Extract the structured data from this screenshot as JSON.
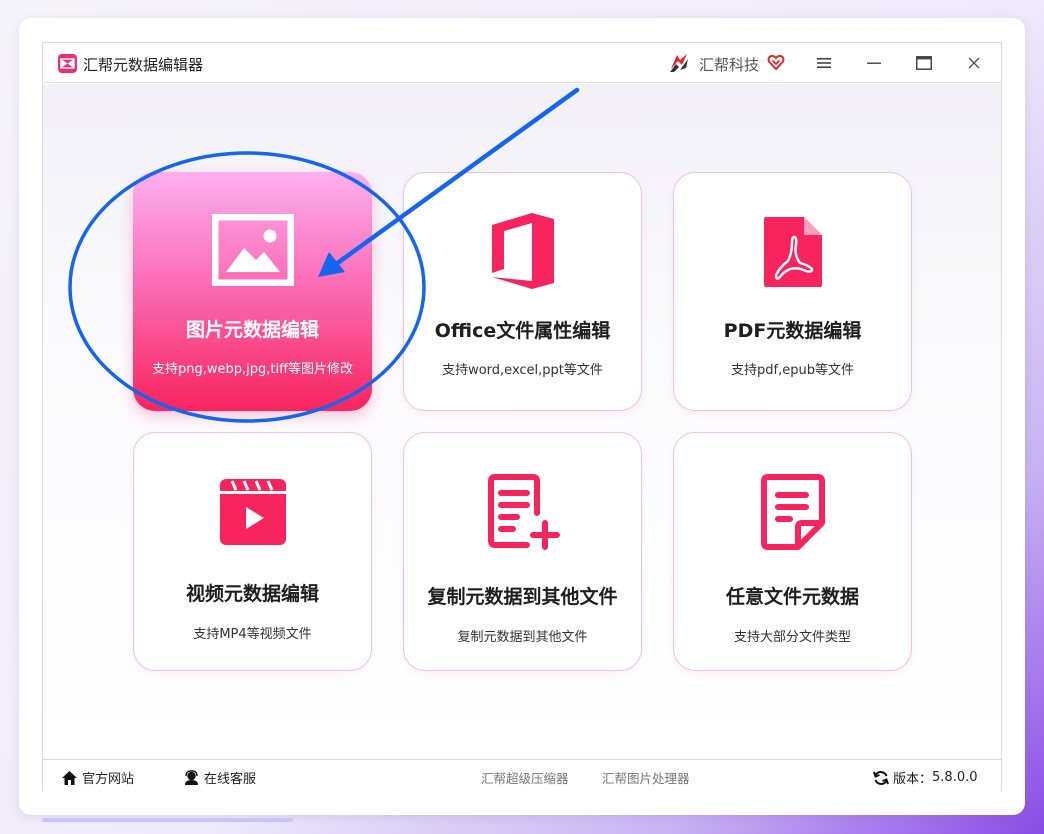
{
  "titlebar": {
    "app_title": "汇帮元数据编辑器",
    "brand_name": "汇帮科技"
  },
  "cards": [
    {
      "title": "图片元数据编辑",
      "desc": "支持png,webp,jpg,tiff等图片修改",
      "icon": "image-icon",
      "selected": true
    },
    {
      "title": "Office文件属性编辑",
      "desc": "支持word,excel,ppt等文件",
      "icon": "office-icon",
      "selected": false
    },
    {
      "title": "PDF元数据编辑",
      "desc": "支持pdf,epub等文件",
      "icon": "pdf-icon",
      "selected": false
    },
    {
      "title": "视频元数据编辑",
      "desc": "支持MP4等视频文件",
      "icon": "video-icon",
      "selected": false
    },
    {
      "title": "复制元数据到其他文件",
      "desc": "复制元数据到其他文件",
      "icon": "copy-doc-icon",
      "selected": false
    },
    {
      "title": "任意文件元数据",
      "desc": "支持大部分文件类型",
      "icon": "any-file-icon",
      "selected": false
    }
  ],
  "footer": {
    "website": "官方网站",
    "support": "在线客服",
    "compressor": "汇帮超级压缩器",
    "image_tool": "汇帮图片处理器",
    "version_label": "版本：",
    "version": "5.8.0.0"
  },
  "colors": {
    "accent": "#f8245e",
    "card_border": "#f4bfe6",
    "annotation_blue": "#1565f0"
  }
}
